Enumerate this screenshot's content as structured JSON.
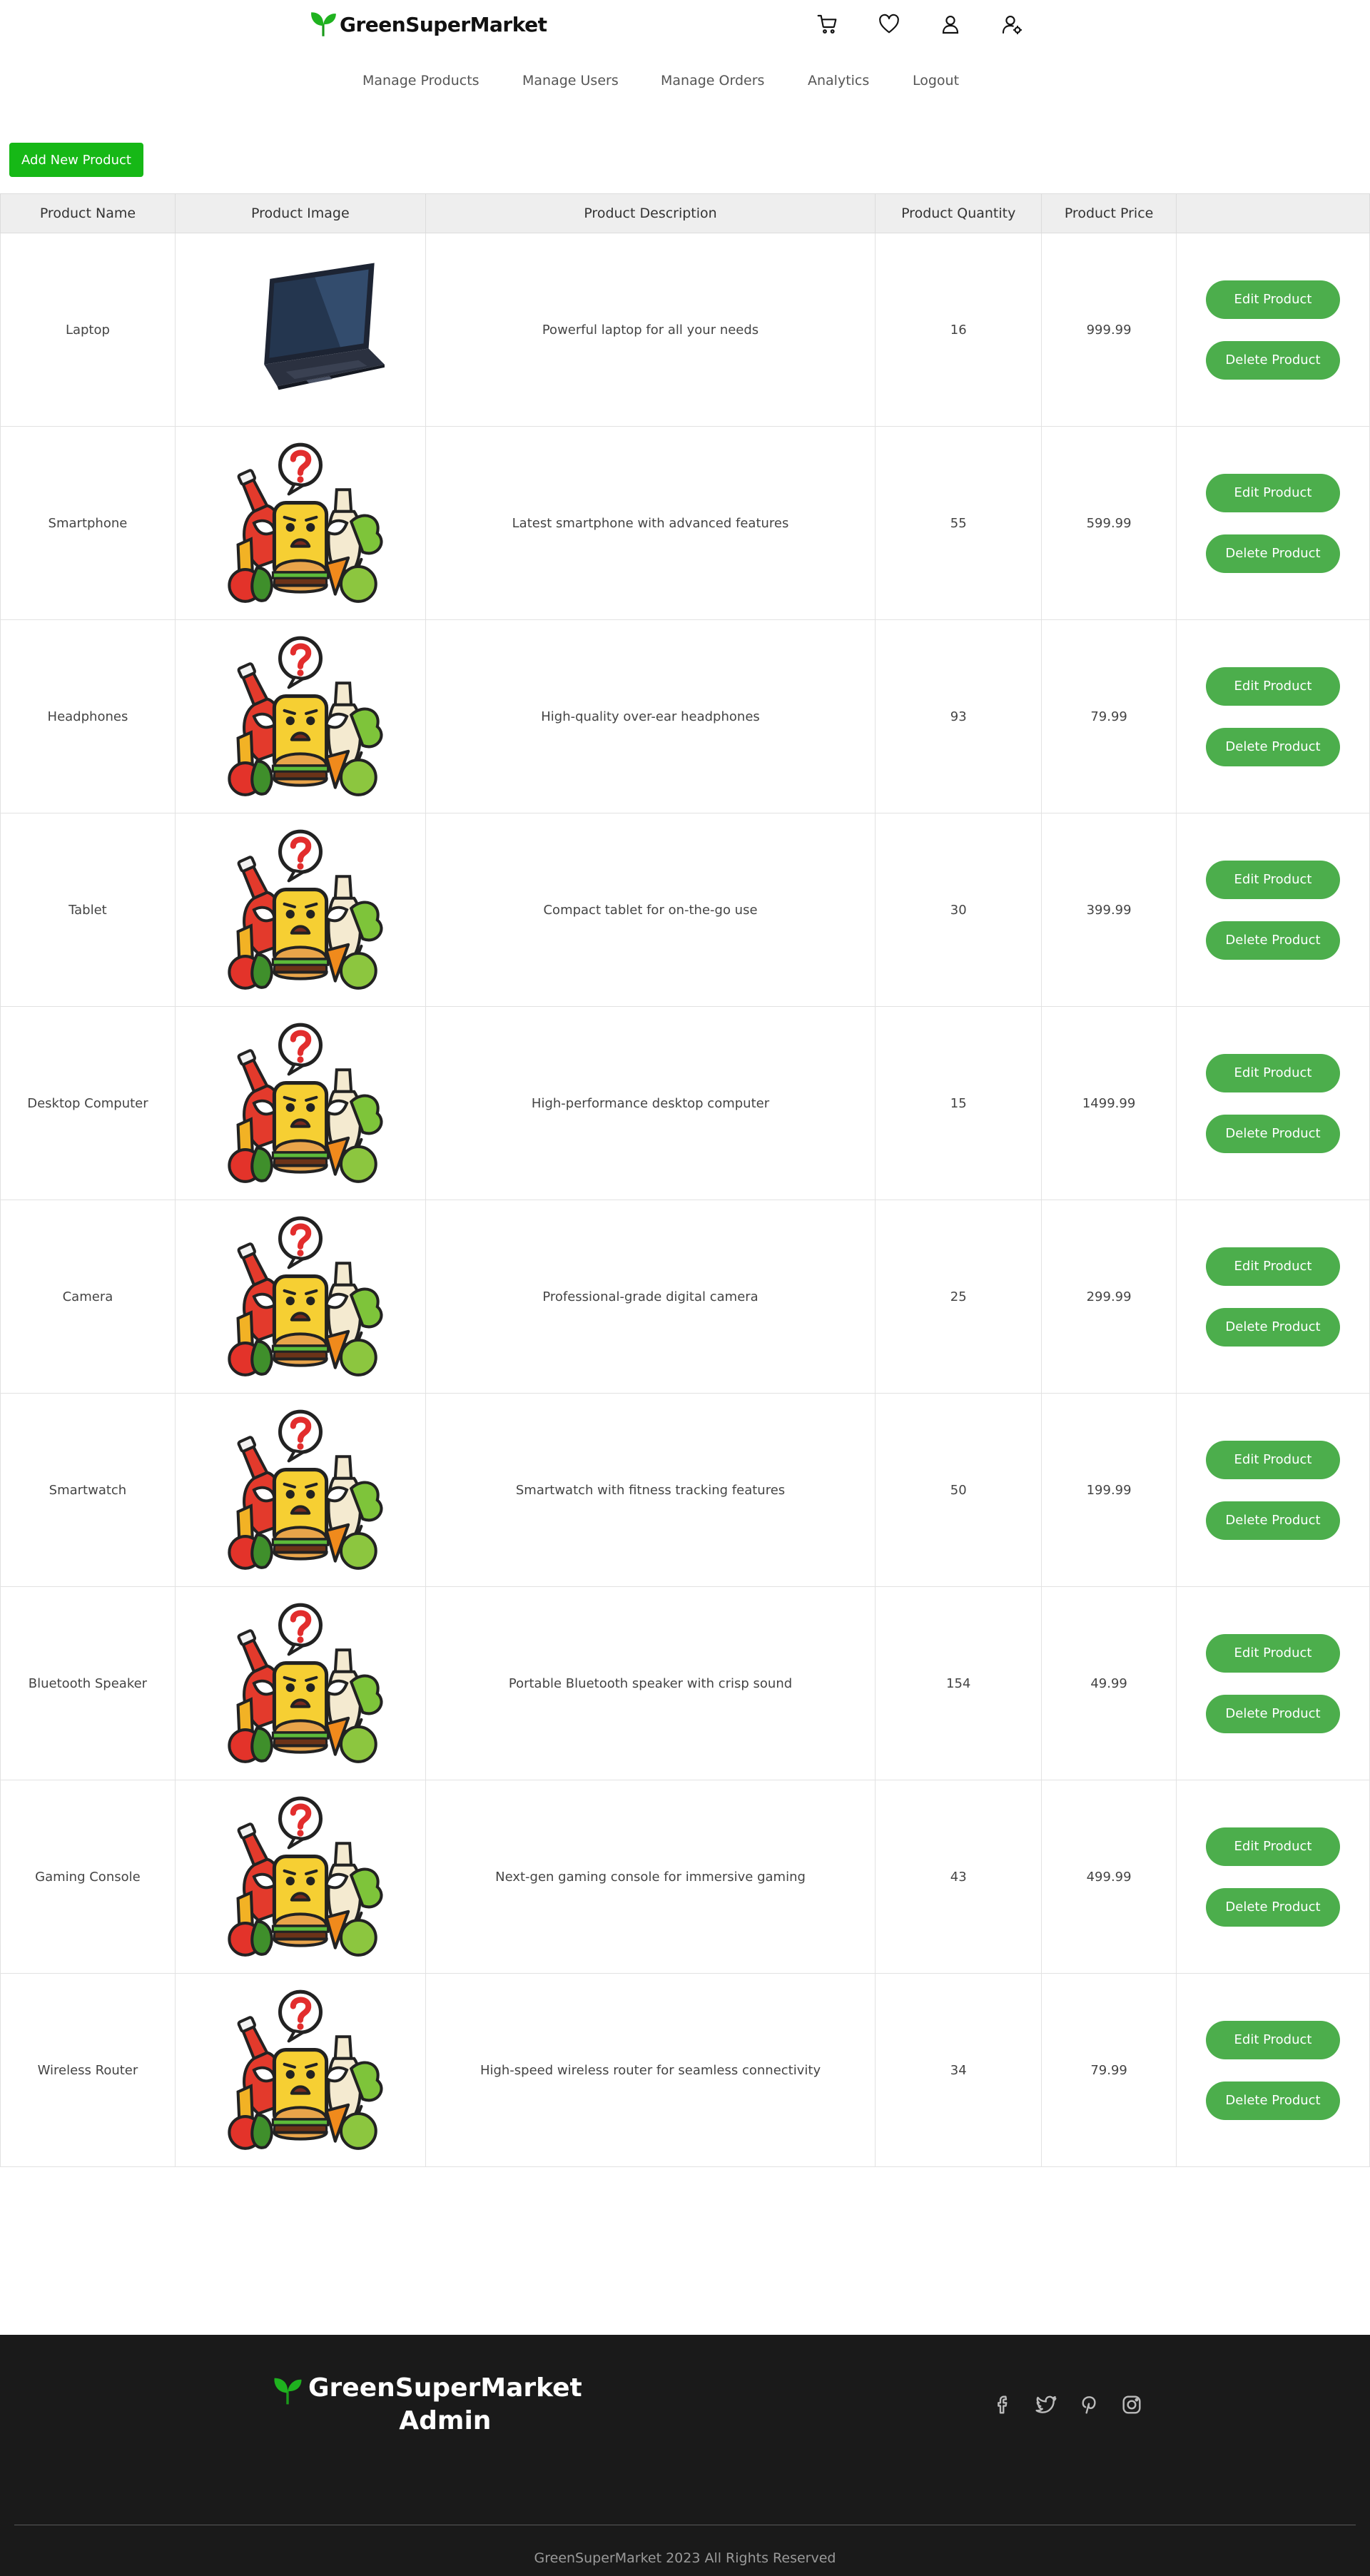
{
  "brand": {
    "name": "GreenSuperMarket"
  },
  "header_icons": [
    "cart-icon",
    "heart-icon",
    "user-icon",
    "user-settings-icon"
  ],
  "nav": {
    "items": [
      {
        "label": "Manage Products"
      },
      {
        "label": "Manage Users"
      },
      {
        "label": "Manage Orders"
      },
      {
        "label": "Analytics"
      },
      {
        "label": "Logout"
      }
    ]
  },
  "toolbar": {
    "add_label": "Add New Product"
  },
  "table": {
    "headers": [
      "Product Name",
      "Product Image",
      "Product Description",
      "Product Quantity",
      "Product Price",
      ""
    ],
    "edit_label": "Edit Product",
    "delete_label": "Delete Product",
    "rows": [
      {
        "name": "Laptop",
        "image": "laptop-photo",
        "description": "Powerful laptop for all your needs",
        "quantity": "16",
        "price": "999.99"
      },
      {
        "name": "Smartphone",
        "image": "placeholder-food-mascot",
        "description": "Latest smartphone with advanced features",
        "quantity": "55",
        "price": "599.99"
      },
      {
        "name": "Headphones",
        "image": "placeholder-food-mascot",
        "description": "High-quality over-ear headphones",
        "quantity": "93",
        "price": "79.99"
      },
      {
        "name": "Tablet",
        "image": "placeholder-food-mascot",
        "description": "Compact tablet for on-the-go use",
        "quantity": "30",
        "price": "399.99"
      },
      {
        "name": "Desktop Computer",
        "image": "placeholder-food-mascot",
        "description": "High-performance desktop computer",
        "quantity": "15",
        "price": "1499.99"
      },
      {
        "name": "Camera",
        "image": "placeholder-food-mascot",
        "description": "Professional-grade digital camera",
        "quantity": "25",
        "price": "299.99"
      },
      {
        "name": "Smartwatch",
        "image": "placeholder-food-mascot",
        "description": "Smartwatch with fitness tracking features",
        "quantity": "50",
        "price": "199.99"
      },
      {
        "name": "Bluetooth Speaker",
        "image": "placeholder-food-mascot",
        "description": "Portable Bluetooth speaker with crisp sound",
        "quantity": "154",
        "price": "49.99"
      },
      {
        "name": "Gaming Console",
        "image": "placeholder-food-mascot",
        "description": "Next-gen gaming console for immersive gaming",
        "quantity": "43",
        "price": "499.99"
      },
      {
        "name": "Wireless Router",
        "image": "placeholder-food-mascot",
        "description": "High-speed wireless router for seamless connectivity",
        "quantity": "34",
        "price": "79.99"
      }
    ]
  },
  "footer": {
    "title_line1": "GreenSuperMarket",
    "title_line2": "Admin",
    "social": [
      "facebook-icon",
      "twitter-icon",
      "pinterest-icon",
      "instagram-icon"
    ],
    "copyright": "GreenSuperMarket 2023 All Rights Reserved"
  },
  "colors": {
    "brand_green": "#16b816",
    "button_green": "#4cae4c",
    "footer_bg": "#1a1a1a"
  }
}
